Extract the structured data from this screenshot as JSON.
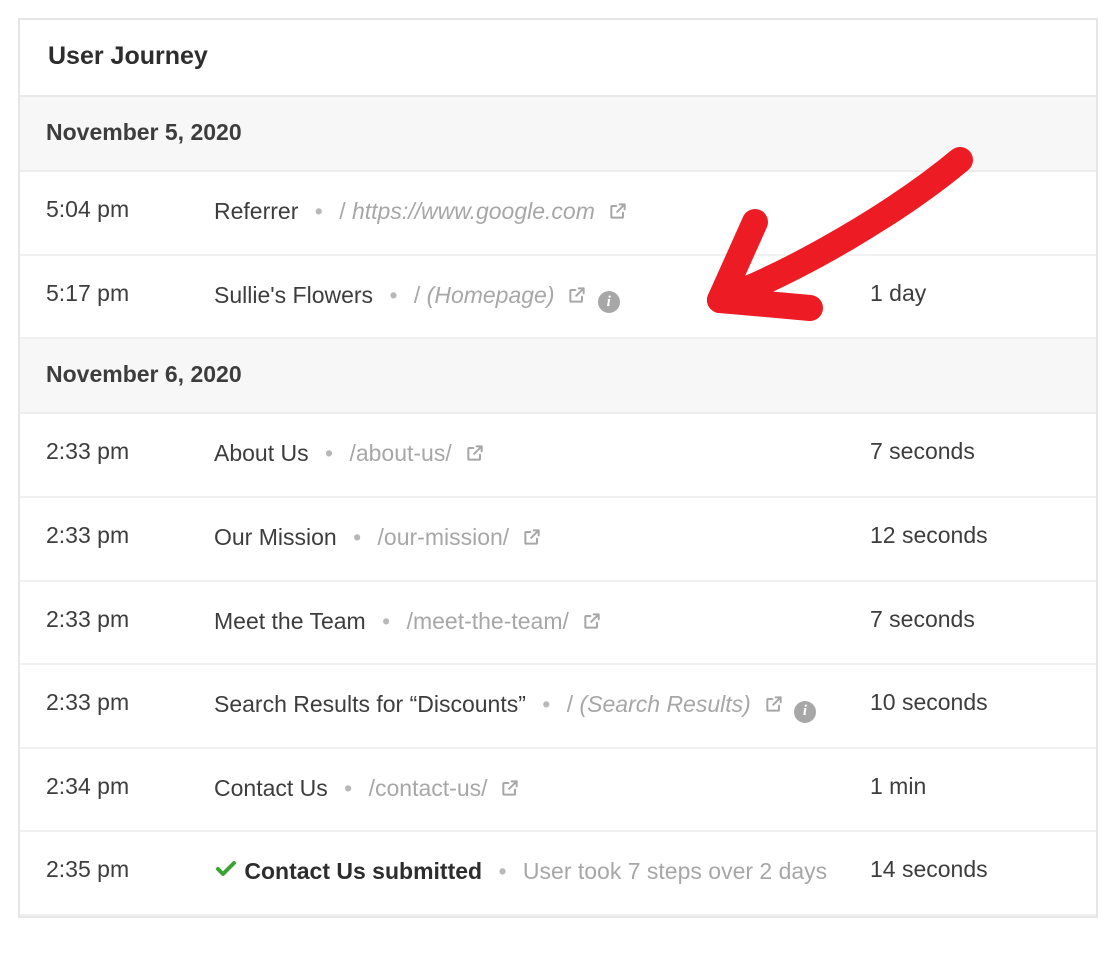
{
  "panel": {
    "title": "User Journey"
  },
  "groups": [
    {
      "date": "November 5, 2020",
      "entries": [
        {
          "time": "5:04 pm",
          "title": "Referrer",
          "path": "https://www.google.com",
          "path_italic": true,
          "externalLink": true,
          "info": false,
          "duration": ""
        },
        {
          "time": "5:17 pm",
          "title": "Sullie's Flowers",
          "path": "(Homepage)",
          "path_italic": true,
          "externalLink": true,
          "info": true,
          "duration": "1 day",
          "highlight": true
        }
      ]
    },
    {
      "date": "November 6, 2020",
      "entries": [
        {
          "time": "2:33 pm",
          "title": "About Us",
          "path": "/about-us/",
          "path_italic": false,
          "externalLink": true,
          "info": false,
          "duration": "7 seconds"
        },
        {
          "time": "2:33 pm",
          "title": "Our Mission",
          "path": "/our-mission/",
          "path_italic": false,
          "externalLink": true,
          "info": false,
          "duration": "12 seconds"
        },
        {
          "time": "2:33 pm",
          "title": "Meet the Team",
          "path": "/meet-the-team/",
          "path_italic": false,
          "externalLink": true,
          "info": false,
          "duration": "7 seconds"
        },
        {
          "time": "2:33 pm",
          "title": "Search Results for “Discounts”",
          "path": "(Search Results)",
          "path_italic": true,
          "slash": true,
          "externalLink": true,
          "info": true,
          "duration": "10 seconds"
        },
        {
          "time": "2:34 pm",
          "title": "Contact Us",
          "path": "/contact-us/",
          "path_italic": false,
          "externalLink": true,
          "info": false,
          "duration": "1 min"
        },
        {
          "time": "2:35 pm",
          "type": "submission",
          "submissionTitle": "Contact Us submitted",
          "summary": "User took 7 steps over 2 days",
          "duration": "14 seconds"
        }
      ]
    }
  ]
}
